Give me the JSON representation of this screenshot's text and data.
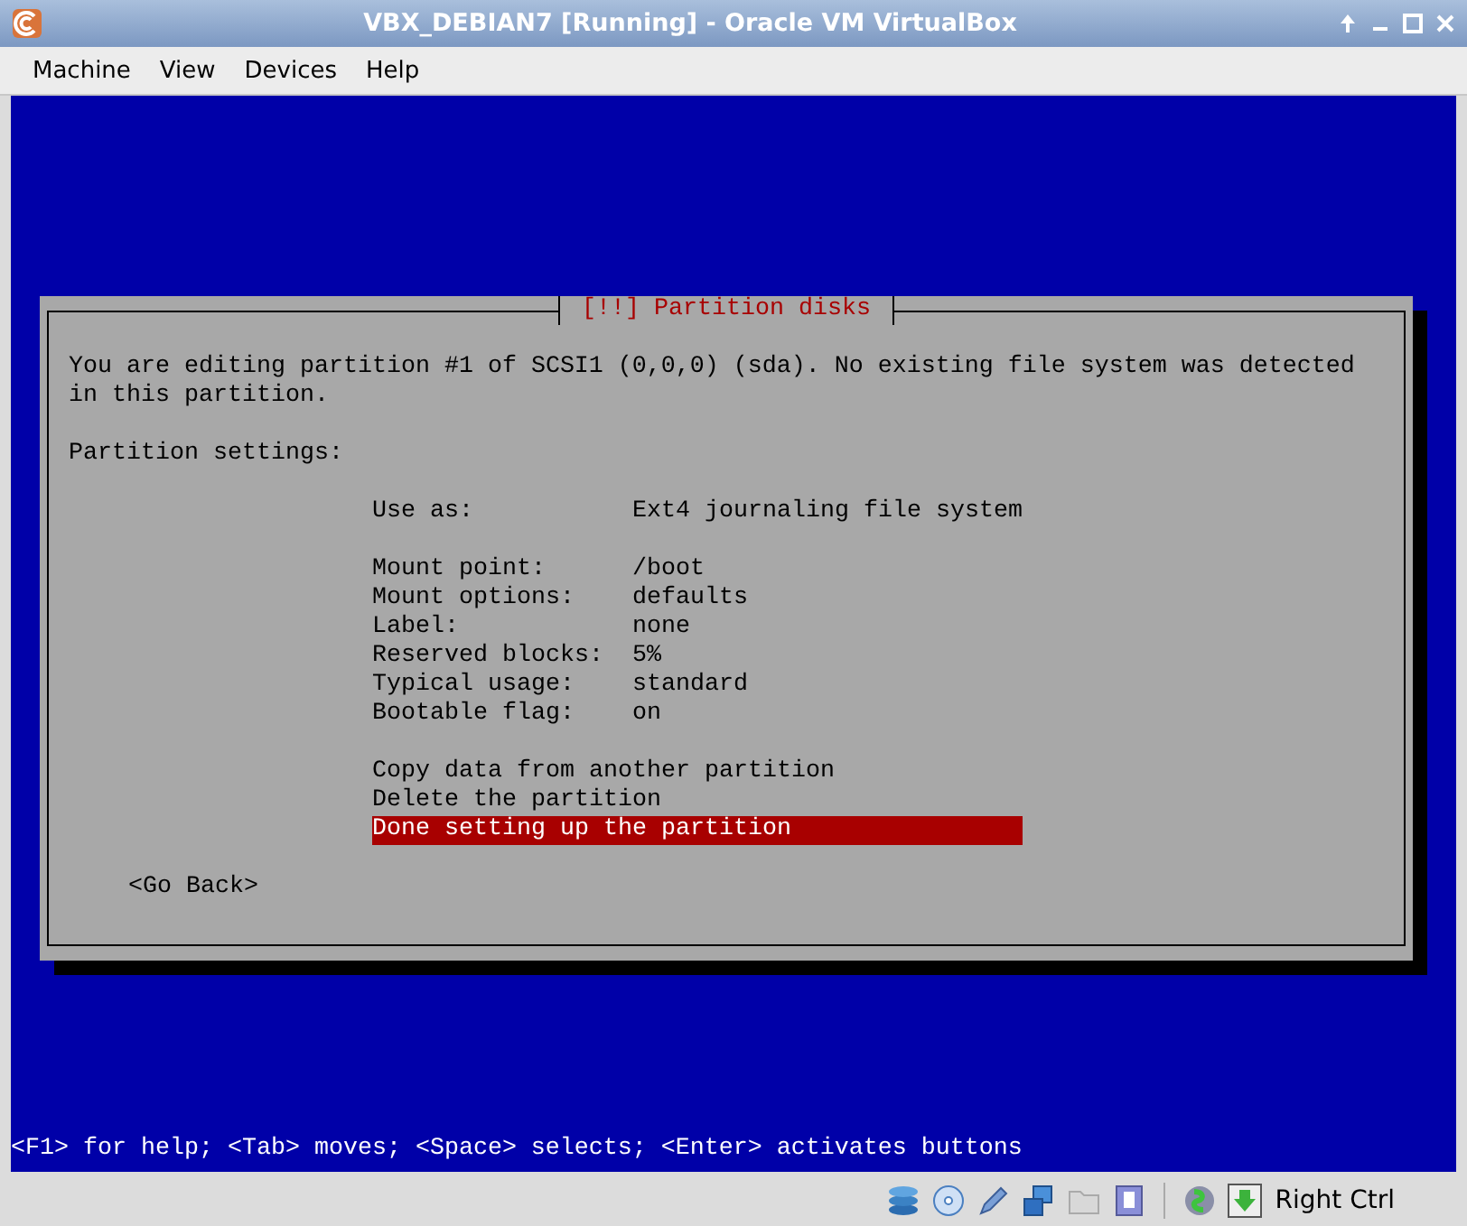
{
  "window": {
    "title": "VBX_DEBIAN7 [Running] - Oracle VM VirtualBox"
  },
  "menu": [
    "Machine",
    "View",
    "Devices",
    "Help"
  ],
  "dialog": {
    "title": "[!!] Partition disks",
    "message": "You are editing partition #1 of SCSI1 (0,0,0) (sda). No existing file system was detected in this partition.",
    "section": "Partition settings:",
    "use_as": {
      "label": "Use as:",
      "value": "Ext4 journaling file system"
    },
    "settings": [
      {
        "label": "Mount point:",
        "value": "/boot"
      },
      {
        "label": "Mount options:",
        "value": "defaults"
      },
      {
        "label": "Label:",
        "value": "none"
      },
      {
        "label": "Reserved blocks:",
        "value": "5%"
      },
      {
        "label": "Typical usage:",
        "value": "standard"
      },
      {
        "label": "Bootable flag:",
        "value": "on"
      }
    ],
    "actions": [
      {
        "label": "Copy data from another partition",
        "selected": false
      },
      {
        "label": "Delete the partition",
        "selected": false
      },
      {
        "label": "Done setting up the partition",
        "selected": true
      }
    ],
    "go_back": "<Go Back>"
  },
  "help_line": "<F1> for help; <Tab> moves; <Space> selects; <Enter> activates buttons",
  "status_bar": {
    "host_key": "Right Ctrl"
  }
}
